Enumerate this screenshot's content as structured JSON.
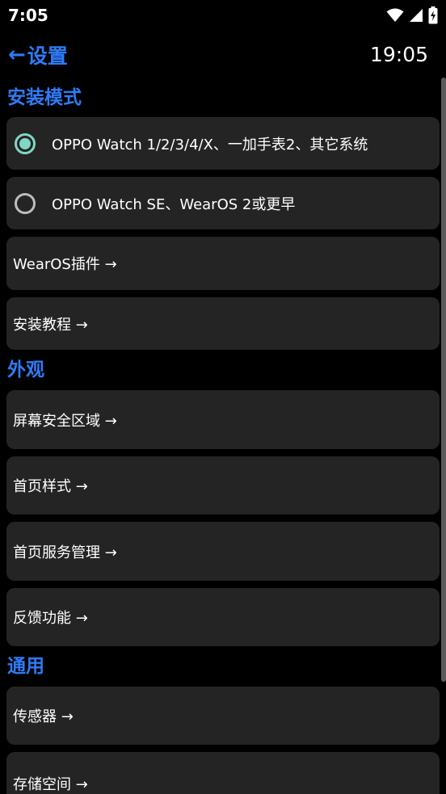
{
  "status_bar": {
    "time": "7:05",
    "icons": [
      "wifi-icon",
      "signal-icon",
      "battery-charging-icon"
    ]
  },
  "header": {
    "back_arrow": "←",
    "title": "设置",
    "clock": "19:05"
  },
  "colors": {
    "accent": "#2f7bf6",
    "card_bg": "#242424",
    "radio_selected": "#7fd7c6",
    "radio_unselected": "#bdbdbd"
  },
  "sections": {
    "install_mode": {
      "title": "安装模式",
      "options": [
        {
          "label": "OPPO Watch 1/2/3/4/X、一加手表2、其它系统",
          "selected": true
        },
        {
          "label": "OPPO Watch SE、WearOS 2或更早",
          "selected": false
        }
      ],
      "items": [
        {
          "label": "WearOS插件 →"
        },
        {
          "label": "安装教程 →"
        }
      ]
    },
    "appearance": {
      "title": "外观",
      "items": [
        {
          "label": "屏幕安全区域 →"
        },
        {
          "label": "首页样式 →"
        },
        {
          "label": "首页服务管理 →"
        },
        {
          "label": "反馈功能 →"
        }
      ]
    },
    "general": {
      "title": "通用",
      "items": [
        {
          "label": "传感器 →"
        },
        {
          "label": "存储空间 →"
        }
      ]
    }
  }
}
